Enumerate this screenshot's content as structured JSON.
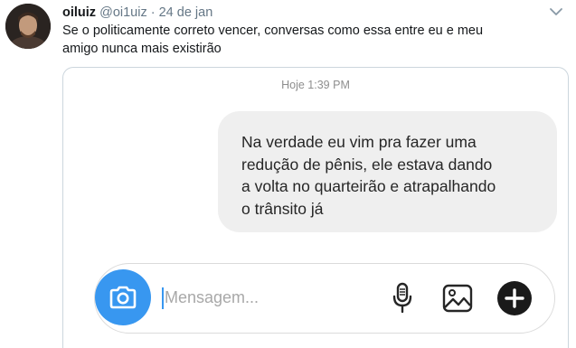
{
  "tweet": {
    "display_name": "oiluiz",
    "handle": "@oi1uiz",
    "separator": "·",
    "date": "24 de jan",
    "text_line1": "Se o politicamente correto vencer, conversas como essa entre eu e meu",
    "text_line2": "amigo nunca mais existirão"
  },
  "chat": {
    "timestamp": "Hoje 1:39 PM",
    "message_lines": [
      "Na verdade eu vim pra fazer uma",
      "redução de pênis, ele estava dando",
      "a volta no quarteirão e atrapalhando",
      "o trânsito já"
    ],
    "composer_placeholder": "Mensagem..."
  },
  "icons": {
    "avatar": "avatar",
    "caret": "chevron-down-icon",
    "camera": "camera-icon",
    "mic": "microphone-icon",
    "gallery": "image-icon",
    "plus": "plus-circle-icon"
  },
  "colors": {
    "accent": "#3897f0",
    "bubble": "#efefef",
    "muted": "#657786"
  }
}
